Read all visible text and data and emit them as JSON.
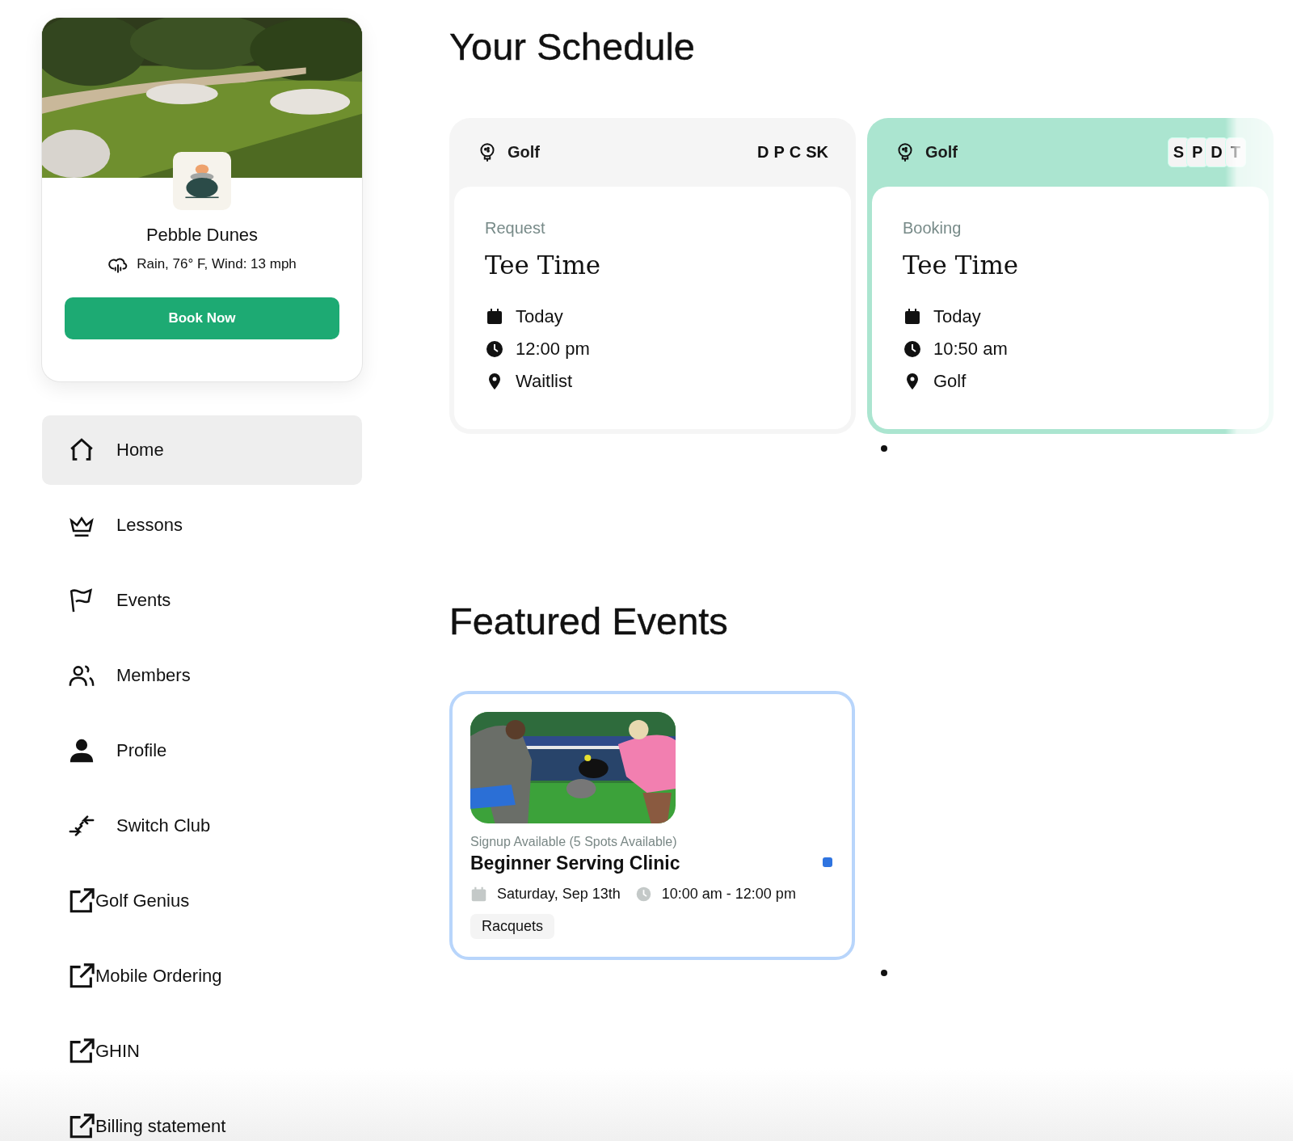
{
  "club": {
    "name": "Pebble Dunes",
    "weather": "Rain, 76° F, Wind: 13 mph",
    "book_button": "Book Now"
  },
  "nav": [
    {
      "label": "Home",
      "kind": "page",
      "selected": true
    },
    {
      "label": "Lessons",
      "kind": "page",
      "selected": false
    },
    {
      "label": "Events",
      "kind": "page",
      "selected": false
    },
    {
      "label": "Members",
      "kind": "page",
      "selected": false
    },
    {
      "label": "Profile",
      "kind": "page",
      "selected": false
    },
    {
      "label": "Switch Club",
      "kind": "page",
      "selected": false
    },
    {
      "label": "Golf Genius",
      "kind": "external",
      "selected": false
    },
    {
      "label": "Mobile Ordering",
      "kind": "external",
      "selected": false
    },
    {
      "label": "GHIN",
      "kind": "external",
      "selected": false
    },
    {
      "label": "Billing statement",
      "kind": "external",
      "selected": false
    }
  ],
  "schedule": {
    "title": "Your Schedule",
    "cards": [
      {
        "category": "Golf",
        "tags": [
          "D",
          "P",
          "C",
          "SK"
        ],
        "selected": false,
        "status": "Request",
        "title": "Tee Time",
        "date": "Today",
        "time": "12:00 pm",
        "location": "Waitlist"
      },
      {
        "category": "Golf",
        "tags": [
          "S",
          "P",
          "D",
          "T"
        ],
        "selected": true,
        "status": "Booking",
        "title": "Tee Time",
        "date": "Today",
        "time": "10:50 am",
        "location": "Golf"
      }
    ]
  },
  "featured": {
    "title": "Featured Events",
    "events": [
      {
        "availability": "Signup Available (5 Spots Available)",
        "title": "Beginner Serving Clinic",
        "color": "#2f74e0",
        "date": "Saturday, Sep 13th",
        "time": "10:00 am - 12:00 pm",
        "tag": "Racquets"
      }
    ]
  }
}
